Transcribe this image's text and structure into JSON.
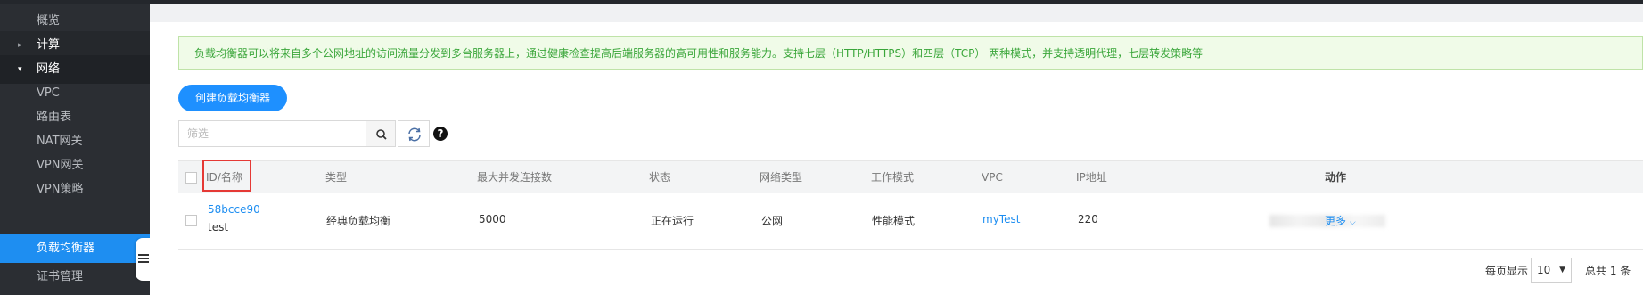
{
  "sidebar": {
    "items": [
      {
        "label": "概览"
      },
      {
        "label": "计算",
        "arrow": "▸"
      },
      {
        "label": "网络",
        "arrow": "▾"
      },
      {
        "label": "VPC"
      },
      {
        "label": "路由表"
      },
      {
        "label": "NAT网关"
      },
      {
        "label": "VPN网关"
      },
      {
        "label": "VPN策略"
      },
      {
        "label": "负载均衡器"
      },
      {
        "label": "证书管理"
      }
    ]
  },
  "notice": "负载均衡器可以将来自多个公网地址的访问流量分发到多台服务器上，通过健康检查提高后端服务器的高可用性和服务能力。支持七层（HTTP/HTTPS）和四层（TCP） 两种模式，并支持透明代理，七层转发策略等",
  "toolbar": {
    "create_label": "创建负载均衡器",
    "filter_placeholder": "筛选"
  },
  "table": {
    "headers": {
      "id_name": "ID/名称",
      "type": "类型",
      "max_conn": "最大并发连接数",
      "status": "状态",
      "network_type": "网络类型",
      "work_mode": "工作模式",
      "vpc": "VPC",
      "ip": "IP地址",
      "action": "动作"
    },
    "rows": [
      {
        "id": "58bcce90",
        "name": "test",
        "type": "经典负载均衡",
        "max_conn": "5000",
        "status": "正在运行",
        "network_type": "公网",
        "work_mode": "性能模式",
        "vpc": "myTest",
        "ip": "220",
        "action": "更多"
      }
    ]
  },
  "pagination": {
    "per_page_label": "每页显示",
    "per_page_value": "10",
    "total_label": "总共 1 条"
  },
  "colors": {
    "accent": "#1e8ef1",
    "sidebar_bg": "#2b2e33",
    "notice_text": "#3aa63a",
    "highlight": "#e53935"
  }
}
